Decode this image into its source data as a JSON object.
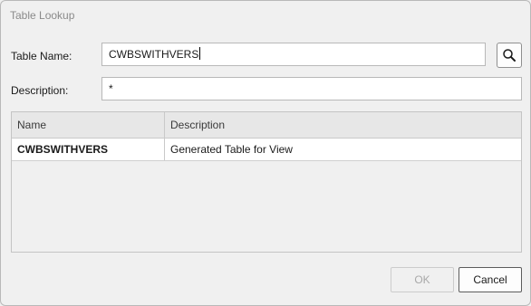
{
  "dialog": {
    "title": "Table Lookup"
  },
  "form": {
    "table_name_label": "Table Name:",
    "table_name_value": "CWBSWITHVERS",
    "description_label": "Description:",
    "description_value": "*",
    "search_icon": "magnifier-icon"
  },
  "grid": {
    "columns": [
      "Name",
      "Description"
    ],
    "rows": [
      {
        "name": "CWBSWITHVERS",
        "description": "Generated Table for View"
      }
    ]
  },
  "buttons": {
    "ok_label": "OK",
    "cancel_label": "Cancel",
    "ok_enabled": false
  }
}
